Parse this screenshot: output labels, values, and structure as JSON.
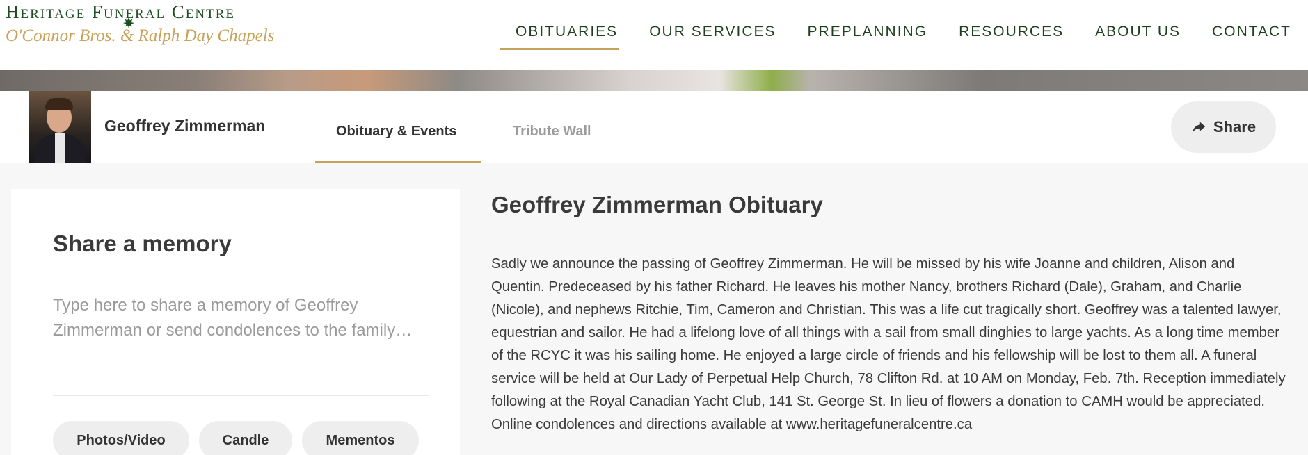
{
  "header": {
    "logo_title": "Heritage Funeral Centre",
    "logo_subtitle": "O'Connor Bros. & Ralph Day Chapels",
    "nav": [
      {
        "label": "OBITUARIES",
        "active": true
      },
      {
        "label": "OUR SERVICES"
      },
      {
        "label": "PREPLANNING"
      },
      {
        "label": "RESOURCES"
      },
      {
        "label": "ABOUT US"
      },
      {
        "label": "CONTACT"
      }
    ]
  },
  "profile": {
    "name": "Geoffrey Zimmerman",
    "tabs": [
      {
        "label": "Obituary & Events",
        "active": true
      },
      {
        "label": "Tribute Wall"
      }
    ],
    "share_label": "Share"
  },
  "memory": {
    "title": "Share a memory",
    "placeholder": "Type here to share a memory of Geoffrey Zimmerman or send condolences to the family…",
    "buttons": [
      "Photos/Video",
      "Candle",
      "Mementos"
    ]
  },
  "obituary": {
    "title": "Geoffrey Zimmerman Obituary",
    "text": "Sadly we announce the passing of Geoffrey Zimmerman. He will be missed by his wife Joanne and children, Alison and Quentin. Predeceased by his father Richard. He leaves his mother Nancy, brothers Richard (Dale), Graham, and Charlie (Nicole), and nephews Ritchie, Tim, Cameron and Christian. This was a life cut tragically short. Geoffrey was a talented lawyer, equestrian and sailor. He had a lifelong love of all things with a sail from small dinghies to large yachts. As a long time member of the RCYC it was his sailing home. He enjoyed a large circle of friends and his fellowship will be lost to them all. A funeral service will be held at Our Lady of Perpetual Help Church, 78 Clifton Rd. at 10 AM on Monday, Feb. 7th. Reception immediately following at the Royal Canadian Yacht Club, 141 St. George St. In lieu of flowers a donation to CAMH would be appreciated. Online condolences and directions available at www.heritagefuneralcentre.ca"
  },
  "colors": {
    "brand_green": "#1f4d22",
    "accent_gold": "#c9a25a",
    "page_bg": "#f7f7f7"
  },
  "icons": {
    "share": "share-arrow-icon",
    "logo_leaf": "maple-leaf-icon"
  }
}
